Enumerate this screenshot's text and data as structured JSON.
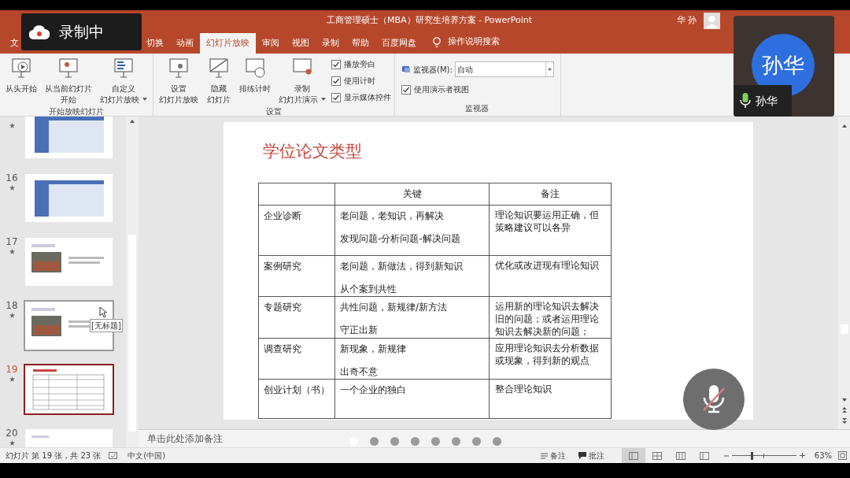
{
  "recording_badge": {
    "label": "录制中"
  },
  "window": {
    "title": "工商管理硕士（MBA）研究生培养方案  -  PowerPoint",
    "user": "华 孙"
  },
  "tabs": [
    {
      "label": "文",
      "selected": false
    },
    {
      "label": "切换",
      "selected": false
    },
    {
      "label": "动画",
      "selected": false
    },
    {
      "label": "幻灯片放映",
      "selected": true
    },
    {
      "label": "审阅",
      "selected": false
    },
    {
      "label": "视图",
      "selected": false
    },
    {
      "label": "录制",
      "selected": false
    },
    {
      "label": "帮助",
      "selected": false
    },
    {
      "label": "百度网盘",
      "selected": false
    }
  ],
  "tell_me": "操作说明搜索",
  "ribbon": {
    "groups": [
      {
        "label": "开始放映幻灯片",
        "items": [
          {
            "kind": "button",
            "lines": [
              "从头开始"
            ],
            "dropdown": false
          },
          {
            "kind": "button",
            "lines": [
              "从当前幻灯片",
              "开始"
            ],
            "dropdown": false
          },
          {
            "kind": "button",
            "lines": [
              "自定义",
              "幻灯片放映"
            ],
            "dropdown": true
          }
        ]
      },
      {
        "label": "设置",
        "items": [
          {
            "kind": "button",
            "lines": [
              "设置",
              "幻灯片放映"
            ],
            "dropdown": false
          },
          {
            "kind": "button",
            "lines": [
              "隐藏",
              "幻灯片"
            ],
            "dropdown": false
          },
          {
            "kind": "button",
            "lines": [
              "排练计时"
            ],
            "dropdown": false
          },
          {
            "kind": "button",
            "lines": [
              "录制",
              "幻灯片演示"
            ],
            "dropdown": true
          },
          {
            "kind": "checkbox",
            "label": "播放旁白",
            "checked": true
          },
          {
            "kind": "checkbox",
            "label": "使用计时",
            "checked": true
          },
          {
            "kind": "checkbox",
            "label": "显示媒体控件",
            "checked": true
          }
        ]
      },
      {
        "label": "监视器",
        "items": [
          {
            "kind": "select",
            "label": "监视器(M):",
            "value": "自动"
          },
          {
            "kind": "checkbox",
            "label": "使用演示者视图",
            "checked": true
          }
        ]
      }
    ]
  },
  "slides": [
    {
      "kind": "blue-table",
      "selected": false,
      "hovered": false
    },
    {
      "number": "16",
      "kind": "blue-table",
      "selected": false,
      "hovered": false
    },
    {
      "number": "17",
      "kind": "photo",
      "selected": false,
      "hovered": false
    },
    {
      "number": "18",
      "kind": "photo",
      "selected": false,
      "hovered": true,
      "tooltip": "[无标题]"
    },
    {
      "number": "19",
      "kind": "table",
      "selected": true,
      "hovered": false
    },
    {
      "number": "20",
      "kind": "text",
      "selected": false,
      "hovered": false
    }
  ],
  "slide": {
    "title": "学位论文类型",
    "columns": [
      "关键",
      "备注"
    ],
    "rows": [
      {
        "label": "企业诊断",
        "key": [
          "老问题，老知识，再解决",
          "发现问题-分析问题-解决问题"
        ],
        "note": "理论知识要运用正确，但策略建议可以各异"
      },
      {
        "label": "案例研究",
        "key": [
          "老问题，新做法，得到新知识",
          "从个案到共性"
        ],
        "note": "优化或改进现有理论知识"
      },
      {
        "label": "专题研究",
        "key": [
          "共性问题，新规律/新方法",
          "守正出新"
        ],
        "note": "运用新的理论知识去解决旧的问题；或者运用理论知识去解决新的问题；"
      },
      {
        "label": "调查研究",
        "key": [
          "新现象，新规律",
          "出奇不意"
        ],
        "note": "应用理论知识去分析数据或现象，得到新的观点"
      },
      {
        "label": "创业计划（书）",
        "key": [
          "一个企业的独白"
        ],
        "note": "整合理论知识"
      }
    ]
  },
  "notes": {
    "placeholder": "单击此处添加备注"
  },
  "page_dots": [
    {
      "selected": true
    },
    {
      "selected": false
    },
    {
      "selected": false
    },
    {
      "selected": false
    },
    {
      "selected": false
    },
    {
      "selected": false
    },
    {
      "selected": false
    },
    {
      "selected": false
    }
  ],
  "participant": {
    "avatar": "孙华",
    "name": "孙华"
  },
  "mic_button": {
    "muted": true
  },
  "status_bar": {
    "slide_info": "幻灯片 第 19 张，共 23 张",
    "language": "中文(中国)",
    "notes": "备注",
    "comments": "批注",
    "views": [
      {
        "selected": true
      },
      {
        "selected": false
      },
      {
        "selected": false
      },
      {
        "selected": false
      }
    ],
    "zoom": {
      "level": 0.3,
      "reading": "63%"
    }
  }
}
